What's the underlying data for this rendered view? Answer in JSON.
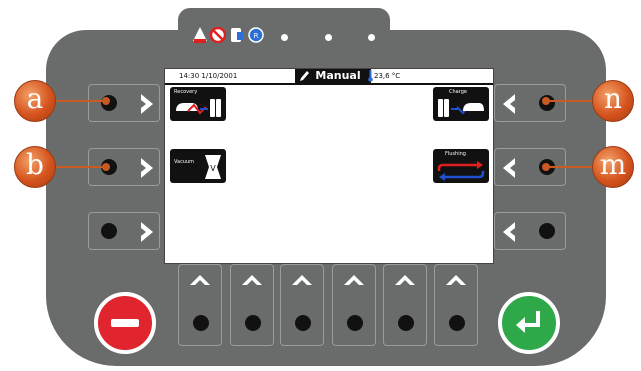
{
  "status_bar": {
    "datetime": "14:30 1/10/2001",
    "mode": "Manual",
    "temperature": "23,6 °C"
  },
  "functions": {
    "recovery": "Recovery",
    "vacuum": "Vacuum",
    "charge": "Charge",
    "flushing": "Flushing"
  },
  "callouts": {
    "a": "a",
    "b": "b",
    "n": "n",
    "m": "m"
  },
  "colors": {
    "panel": "#6a6c6c",
    "cancel_button": "#e0252e",
    "enter_button": "#2fa84a",
    "callout": "#d5541e",
    "flushing_arrow_red": "#e02020",
    "flushing_arrow_blue": "#2050d0"
  },
  "icons": {
    "top_indicators": [
      "warning-icon",
      "no-entry-icon",
      "vehicle-door-icon",
      "refrigerant-icon"
    ],
    "cancel": "minus-icon",
    "enter": "enter-arrow-icon"
  }
}
